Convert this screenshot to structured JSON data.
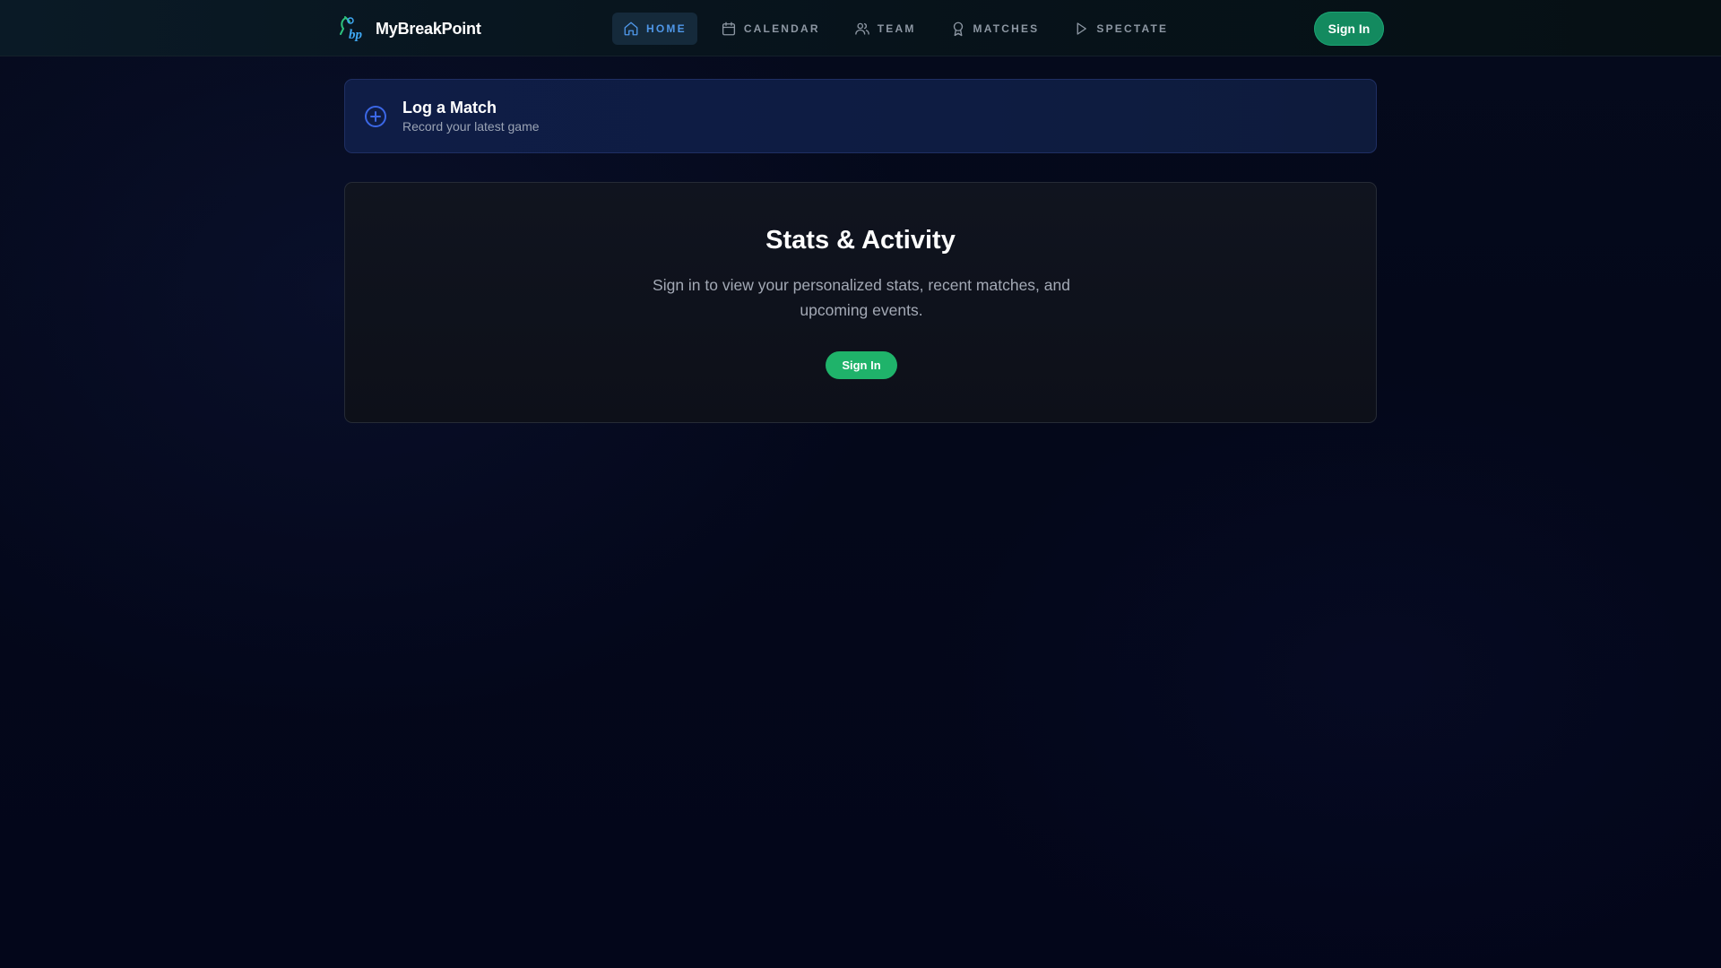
{
  "header": {
    "brand_name": "MyBreakPoint",
    "logo_text": "bp",
    "sign_in_label": "Sign In",
    "nav": [
      {
        "label": "HOME",
        "icon": "home-icon",
        "active": true
      },
      {
        "label": "CALENDAR",
        "icon": "calendar-icon",
        "active": false
      },
      {
        "label": "TEAM",
        "icon": "team-icon",
        "active": false
      },
      {
        "label": "MATCHES",
        "icon": "award-icon",
        "active": false
      },
      {
        "label": "SPECTATE",
        "icon": "play-icon",
        "active": false
      }
    ]
  },
  "log_match": {
    "title": "Log a Match",
    "subtitle": "Record your latest game",
    "icon": "plus-circle-icon"
  },
  "stats": {
    "title": "Stats & Activity",
    "description": "Sign in to view your personalized stats, recent matches, and upcoming events.",
    "sign_in_label": "Sign In"
  },
  "colors": {
    "accent_green": "#1fb36a",
    "header_signin": "#138a5f",
    "active_nav": "#4f97e8",
    "log_card_bg": "#0f1d46"
  }
}
